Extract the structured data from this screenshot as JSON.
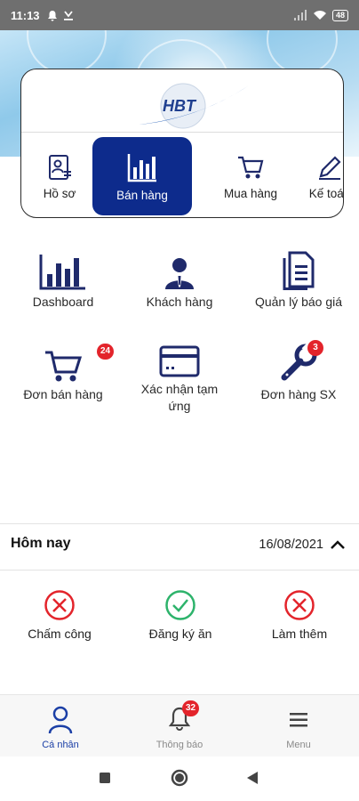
{
  "status_bar": {
    "time": "11:13",
    "left_icons": [
      "notification-bell-icon",
      "download-icon"
    ],
    "right_icons": [
      "signal-icon",
      "wifi-icon"
    ],
    "battery": "48"
  },
  "brand": {
    "logo_text": "HBT",
    "color": "#1f5bb5"
  },
  "modules": [
    {
      "label": "Hồ sơ",
      "icon": "profile-doc-icon",
      "active": false
    },
    {
      "label": "Bán hàng",
      "icon": "bar-chart-icon",
      "active": true
    },
    {
      "label": "Mua hàng",
      "icon": "shopping-cart-icon",
      "active": false
    },
    {
      "label": "Kế toán",
      "icon": "pencil-icon",
      "active": false
    }
  ],
  "features": [
    {
      "label": "Dashboard",
      "icon": "bar-chart-icon"
    },
    {
      "label": "Khách hàng",
      "icon": "customer-icon"
    },
    {
      "label": "Quản lý báo giá",
      "icon": "quotation-doc-icon"
    },
    {
      "label": "Đơn bán hàng",
      "icon": "shopping-cart-icon",
      "badge": "24"
    },
    {
      "label": "Xác nhận tạm ứng",
      "icon": "card-icon"
    },
    {
      "label": "Đơn hàng SX",
      "icon": "wrench-icon",
      "badge": "3"
    }
  ],
  "today": {
    "title": "Hôm nay",
    "date": "16/08/2021",
    "items": [
      {
        "label": "Chấm công",
        "status": "no",
        "color": "#e3242b"
      },
      {
        "label": "Đăng ký ăn",
        "status": "yes",
        "color": "#2db36b"
      },
      {
        "label": "Làm thêm",
        "status": "no",
        "color": "#e3242b"
      }
    ]
  },
  "bottom_nav": [
    {
      "label": "Cá nhân",
      "icon": "person-icon",
      "active": true
    },
    {
      "label": "Thông báo",
      "icon": "bell-icon",
      "badge": "32",
      "active": false
    },
    {
      "label": "Menu",
      "icon": "hamburger-menu-icon",
      "active": false
    }
  ],
  "colors": {
    "primary": "#0d2b8c",
    "badge": "#e3242b",
    "active_nav": "#1b3fa6"
  }
}
